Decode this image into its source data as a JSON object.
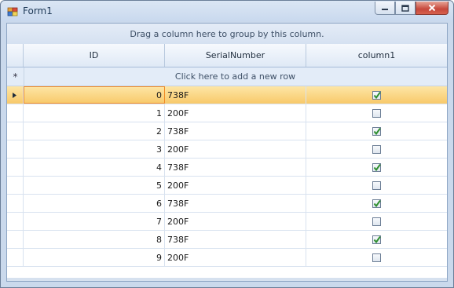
{
  "window": {
    "title": "Form1"
  },
  "grid": {
    "group_panel_text": "Drag a column here to group by this column.",
    "columns": [
      "ID",
      "SerialNumber",
      "column1"
    ],
    "new_row_text": "Click here to add a new row",
    "rows": [
      {
        "id": "0",
        "serial": "738F",
        "checked": true
      },
      {
        "id": "1",
        "serial": "200F",
        "checked": false
      },
      {
        "id": "2",
        "serial": "738F",
        "checked": true
      },
      {
        "id": "3",
        "serial": "200F",
        "checked": false
      },
      {
        "id": "4",
        "serial": "738F",
        "checked": true
      },
      {
        "id": "5",
        "serial": "200F",
        "checked": false
      },
      {
        "id": "6",
        "serial": "738F",
        "checked": true
      },
      {
        "id": "7",
        "serial": "200F",
        "checked": false
      },
      {
        "id": "8",
        "serial": "738F",
        "checked": true
      },
      {
        "id": "9",
        "serial": "200F",
        "checked": false
      }
    ],
    "current_row": 0
  },
  "icons": {
    "app": "form-app-icon",
    "minimize": "minimize-icon",
    "maximize": "maximize-icon",
    "close": "close-icon",
    "new_row": "asterisk-icon",
    "current_row": "row-pointer-icon",
    "check": "check-icon"
  },
  "colors": {
    "current_row": "#f8c96a",
    "focus_border": "#f08a24",
    "check_green": "#2f8f2f"
  }
}
